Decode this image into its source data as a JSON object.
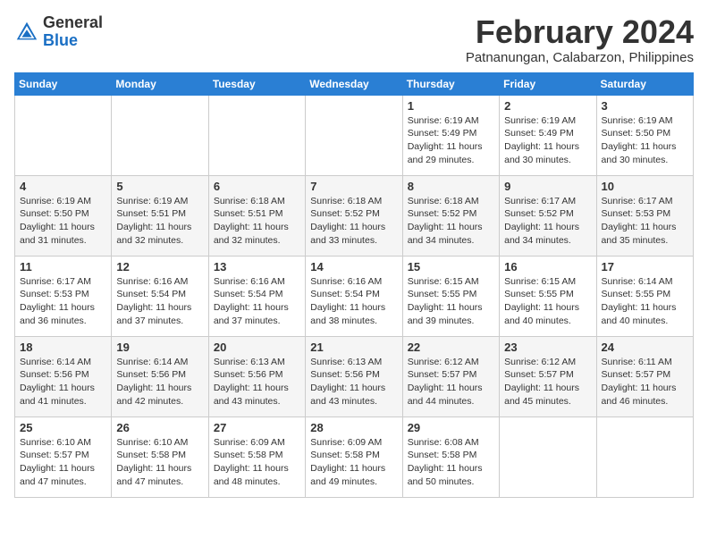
{
  "header": {
    "logo_general": "General",
    "logo_blue": "Blue",
    "month_year": "February 2024",
    "location": "Patnanungan, Calabarzon, Philippines"
  },
  "calendar": {
    "days_of_week": [
      "Sunday",
      "Monday",
      "Tuesday",
      "Wednesday",
      "Thursday",
      "Friday",
      "Saturday"
    ],
    "weeks": [
      [
        {
          "day": "",
          "info": ""
        },
        {
          "day": "",
          "info": ""
        },
        {
          "day": "",
          "info": ""
        },
        {
          "day": "",
          "info": ""
        },
        {
          "day": "1",
          "info": "Sunrise: 6:19 AM\nSunset: 5:49 PM\nDaylight: 11 hours\nand 29 minutes."
        },
        {
          "day": "2",
          "info": "Sunrise: 6:19 AM\nSunset: 5:49 PM\nDaylight: 11 hours\nand 30 minutes."
        },
        {
          "day": "3",
          "info": "Sunrise: 6:19 AM\nSunset: 5:50 PM\nDaylight: 11 hours\nand 30 minutes."
        }
      ],
      [
        {
          "day": "4",
          "info": "Sunrise: 6:19 AM\nSunset: 5:50 PM\nDaylight: 11 hours\nand 31 minutes."
        },
        {
          "day": "5",
          "info": "Sunrise: 6:19 AM\nSunset: 5:51 PM\nDaylight: 11 hours\nand 32 minutes."
        },
        {
          "day": "6",
          "info": "Sunrise: 6:18 AM\nSunset: 5:51 PM\nDaylight: 11 hours\nand 32 minutes."
        },
        {
          "day": "7",
          "info": "Sunrise: 6:18 AM\nSunset: 5:52 PM\nDaylight: 11 hours\nand 33 minutes."
        },
        {
          "day": "8",
          "info": "Sunrise: 6:18 AM\nSunset: 5:52 PM\nDaylight: 11 hours\nand 34 minutes."
        },
        {
          "day": "9",
          "info": "Sunrise: 6:17 AM\nSunset: 5:52 PM\nDaylight: 11 hours\nand 34 minutes."
        },
        {
          "day": "10",
          "info": "Sunrise: 6:17 AM\nSunset: 5:53 PM\nDaylight: 11 hours\nand 35 minutes."
        }
      ],
      [
        {
          "day": "11",
          "info": "Sunrise: 6:17 AM\nSunset: 5:53 PM\nDaylight: 11 hours\nand 36 minutes."
        },
        {
          "day": "12",
          "info": "Sunrise: 6:16 AM\nSunset: 5:54 PM\nDaylight: 11 hours\nand 37 minutes."
        },
        {
          "day": "13",
          "info": "Sunrise: 6:16 AM\nSunset: 5:54 PM\nDaylight: 11 hours\nand 37 minutes."
        },
        {
          "day": "14",
          "info": "Sunrise: 6:16 AM\nSunset: 5:54 PM\nDaylight: 11 hours\nand 38 minutes."
        },
        {
          "day": "15",
          "info": "Sunrise: 6:15 AM\nSunset: 5:55 PM\nDaylight: 11 hours\nand 39 minutes."
        },
        {
          "day": "16",
          "info": "Sunrise: 6:15 AM\nSunset: 5:55 PM\nDaylight: 11 hours\nand 40 minutes."
        },
        {
          "day": "17",
          "info": "Sunrise: 6:14 AM\nSunset: 5:55 PM\nDaylight: 11 hours\nand 40 minutes."
        }
      ],
      [
        {
          "day": "18",
          "info": "Sunrise: 6:14 AM\nSunset: 5:56 PM\nDaylight: 11 hours\nand 41 minutes."
        },
        {
          "day": "19",
          "info": "Sunrise: 6:14 AM\nSunset: 5:56 PM\nDaylight: 11 hours\nand 42 minutes."
        },
        {
          "day": "20",
          "info": "Sunrise: 6:13 AM\nSunset: 5:56 PM\nDaylight: 11 hours\nand 43 minutes."
        },
        {
          "day": "21",
          "info": "Sunrise: 6:13 AM\nSunset: 5:56 PM\nDaylight: 11 hours\nand 43 minutes."
        },
        {
          "day": "22",
          "info": "Sunrise: 6:12 AM\nSunset: 5:57 PM\nDaylight: 11 hours\nand 44 minutes."
        },
        {
          "day": "23",
          "info": "Sunrise: 6:12 AM\nSunset: 5:57 PM\nDaylight: 11 hours\nand 45 minutes."
        },
        {
          "day": "24",
          "info": "Sunrise: 6:11 AM\nSunset: 5:57 PM\nDaylight: 11 hours\nand 46 minutes."
        }
      ],
      [
        {
          "day": "25",
          "info": "Sunrise: 6:10 AM\nSunset: 5:57 PM\nDaylight: 11 hours\nand 47 minutes."
        },
        {
          "day": "26",
          "info": "Sunrise: 6:10 AM\nSunset: 5:58 PM\nDaylight: 11 hours\nand 47 minutes."
        },
        {
          "day": "27",
          "info": "Sunrise: 6:09 AM\nSunset: 5:58 PM\nDaylight: 11 hours\nand 48 minutes."
        },
        {
          "day": "28",
          "info": "Sunrise: 6:09 AM\nSunset: 5:58 PM\nDaylight: 11 hours\nand 49 minutes."
        },
        {
          "day": "29",
          "info": "Sunrise: 6:08 AM\nSunset: 5:58 PM\nDaylight: 11 hours\nand 50 minutes."
        },
        {
          "day": "",
          "info": ""
        },
        {
          "day": "",
          "info": ""
        }
      ]
    ]
  }
}
